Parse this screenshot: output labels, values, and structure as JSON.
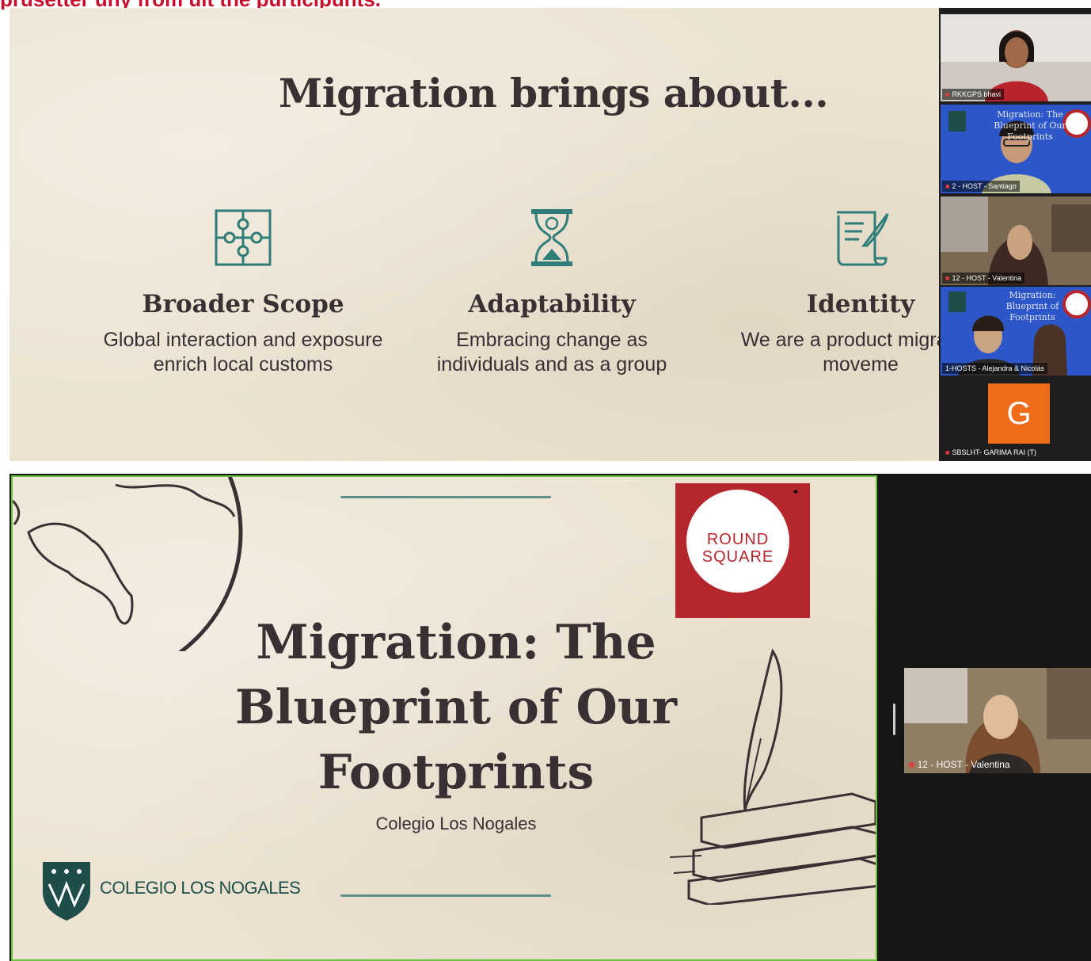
{
  "top_caption": "prusetter uny from uit the purticipunts.",
  "slide1": {
    "title": "Migration brings about...",
    "features": [
      {
        "icon": "puzzle-icon",
        "heading": "Broader Scope",
        "text": "Global interaction and exposure enrich local customs"
      },
      {
        "icon": "hourglass-icon",
        "heading": "Adaptability",
        "text": "Embracing change as individuals and as a group"
      },
      {
        "icon": "scroll-quill-icon",
        "heading": "Identity",
        "text": "We are a product migratory moveme"
      }
    ]
  },
  "gallery": {
    "tiles": [
      {
        "name": "RKKGPS bhavi"
      },
      {
        "name": "2 - HOST - Santiago",
        "slide_text": "Migration: The Blueprint of Our Footprints"
      },
      {
        "name": "12 - HOST - Valentina"
      },
      {
        "name": "1-HOSTS - Alejandra & Nicolás",
        "slide_text": "Migration: Blueprint of Footprints"
      },
      {
        "name": "SBSLHT- GARIMA RAI (T)",
        "avatar": "G"
      }
    ]
  },
  "slide2": {
    "title": "Migration: The Blueprint of Our Footprints",
    "subtitle": "Colegio Los Nogales",
    "round_square": "ROUND SQUARE",
    "school_name": "COLEGIO LOS NOGALES"
  },
  "self_view": {
    "name": "12 - HOST - Valentina"
  },
  "colors": {
    "accent": "#c8102e",
    "teal": "#2e7d78",
    "brand_red": "#b5272d",
    "speaker_border": "#67c23a"
  }
}
